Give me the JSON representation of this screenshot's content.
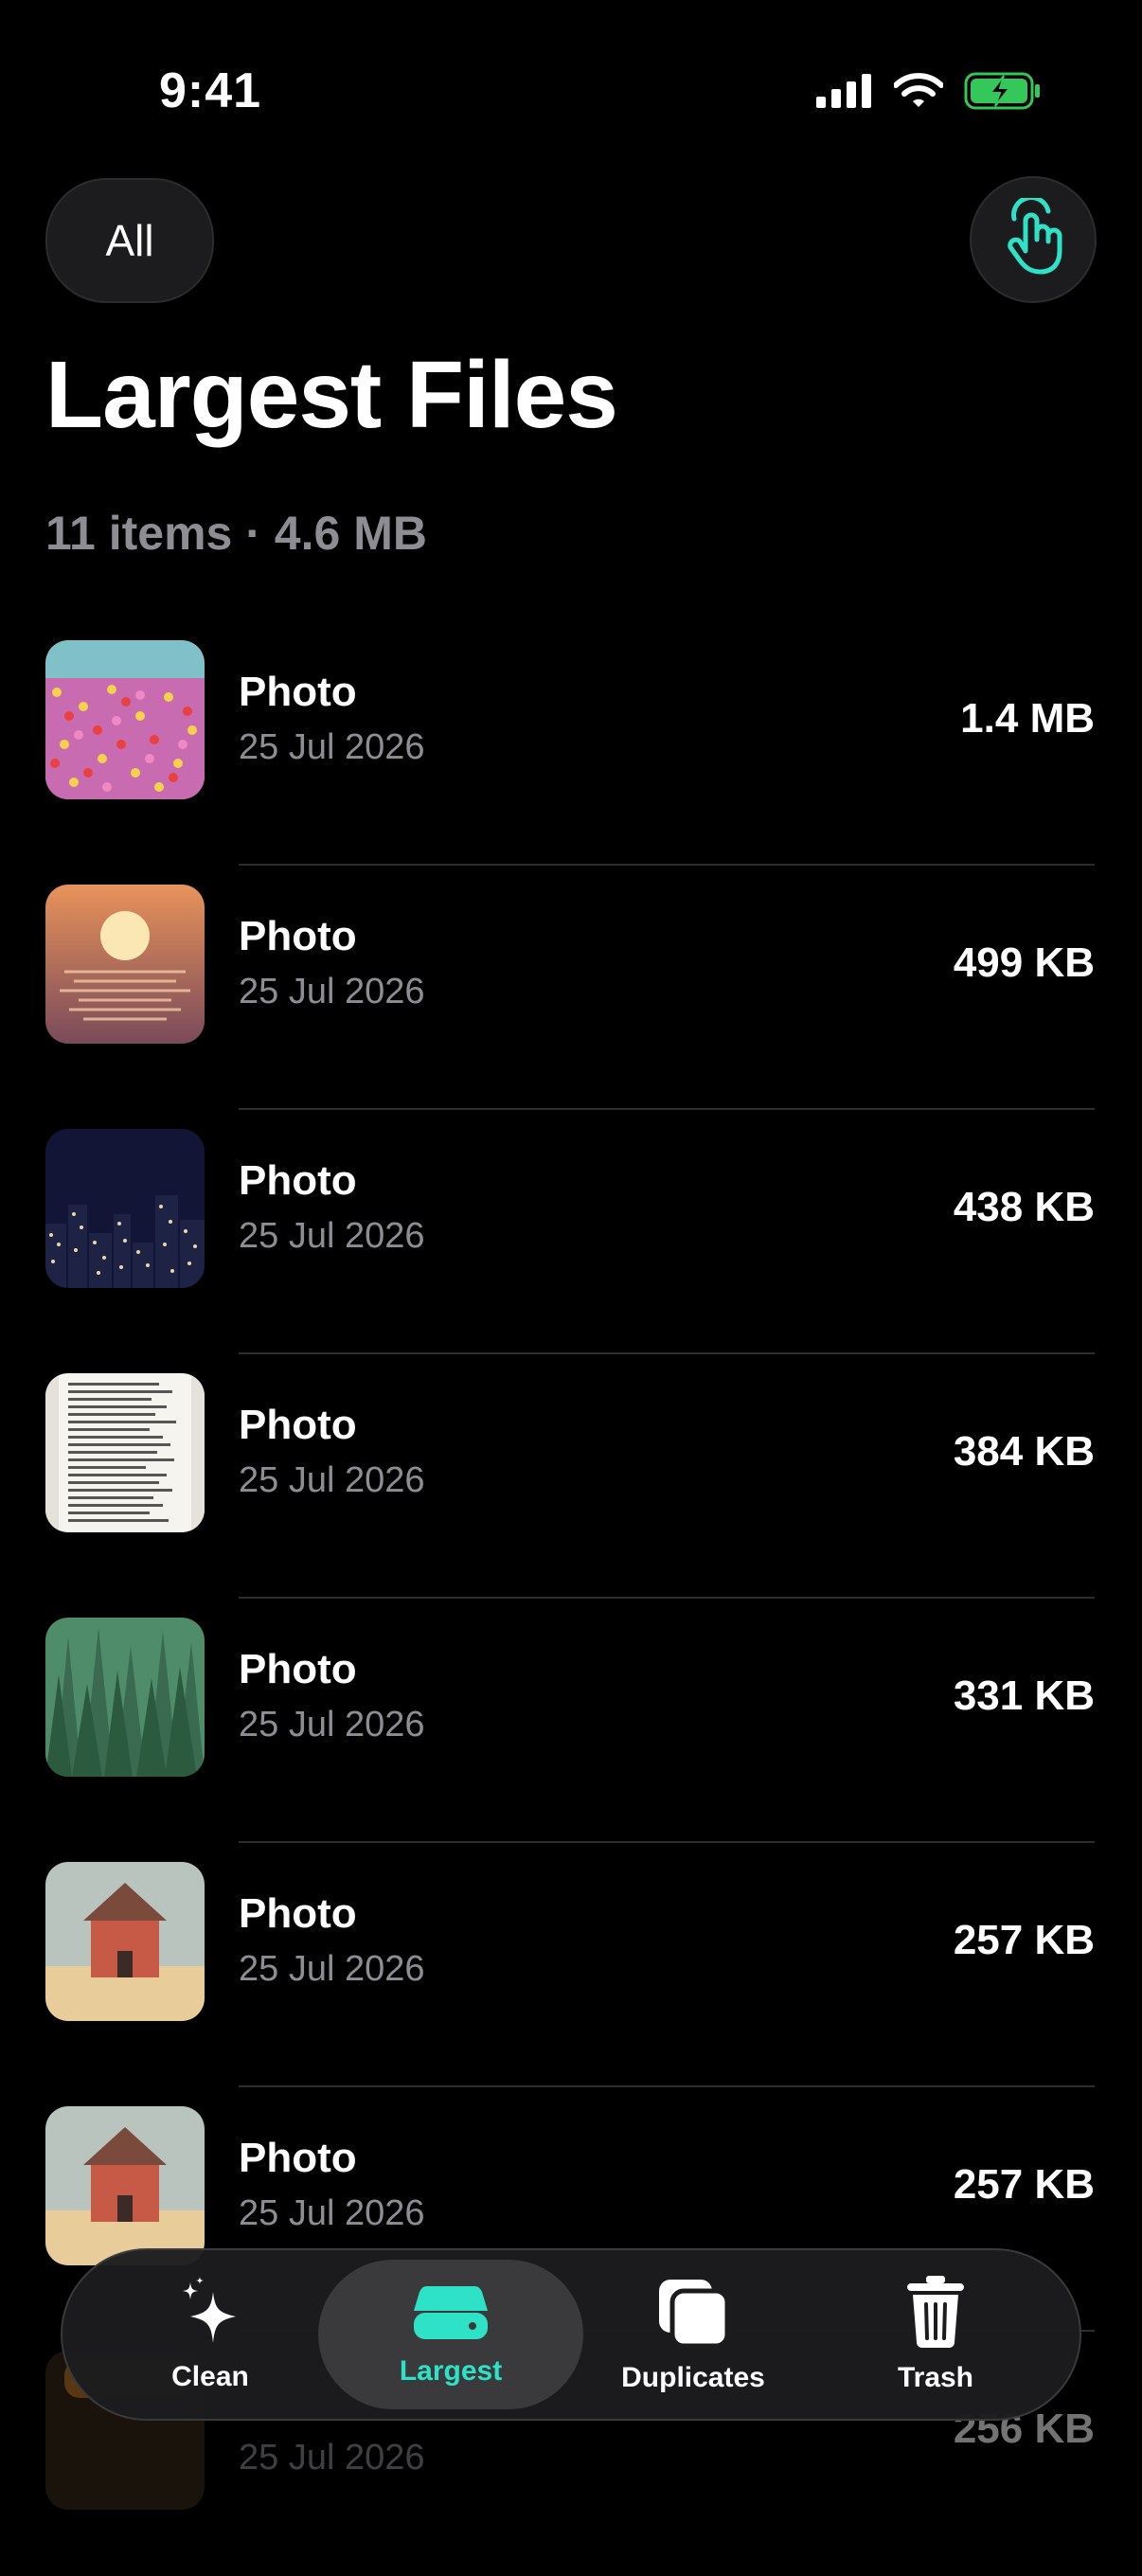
{
  "status": {
    "time": "9:41"
  },
  "header": {
    "filter_label": "All",
    "title": "Largest Files",
    "subtitle": "11 items · 4.6 MB"
  },
  "files": [
    {
      "name": "Photo",
      "date": "25 Jul 2026",
      "size": "1.4 MB"
    },
    {
      "name": "Photo",
      "date": "25 Jul 2026",
      "size": "499 KB"
    },
    {
      "name": "Photo",
      "date": "25 Jul 2026",
      "size": "438 KB"
    },
    {
      "name": "Photo",
      "date": "25 Jul 2026",
      "size": "384 KB"
    },
    {
      "name": "Photo",
      "date": "25 Jul 2026",
      "size": "331 KB"
    },
    {
      "name": "Photo",
      "date": "25 Jul 2026",
      "size": "257 KB"
    },
    {
      "name": "Photo",
      "date": "25 Jul 2026",
      "size": "257 KB"
    },
    {
      "name": "",
      "date": "25 Jul 2026",
      "size": "256 KB"
    }
  ],
  "tabs": [
    {
      "label": "Clean",
      "icon": "sparkles-icon",
      "active": false
    },
    {
      "label": "Largest",
      "icon": "drive-icon",
      "active": true
    },
    {
      "label": "Duplicates",
      "icon": "duplicate-icon",
      "active": false
    },
    {
      "label": "Trash",
      "icon": "trash-icon",
      "active": false
    }
  ],
  "colors": {
    "accent": "#2de2c7",
    "battery": "#34c759",
    "background": "#000000"
  }
}
